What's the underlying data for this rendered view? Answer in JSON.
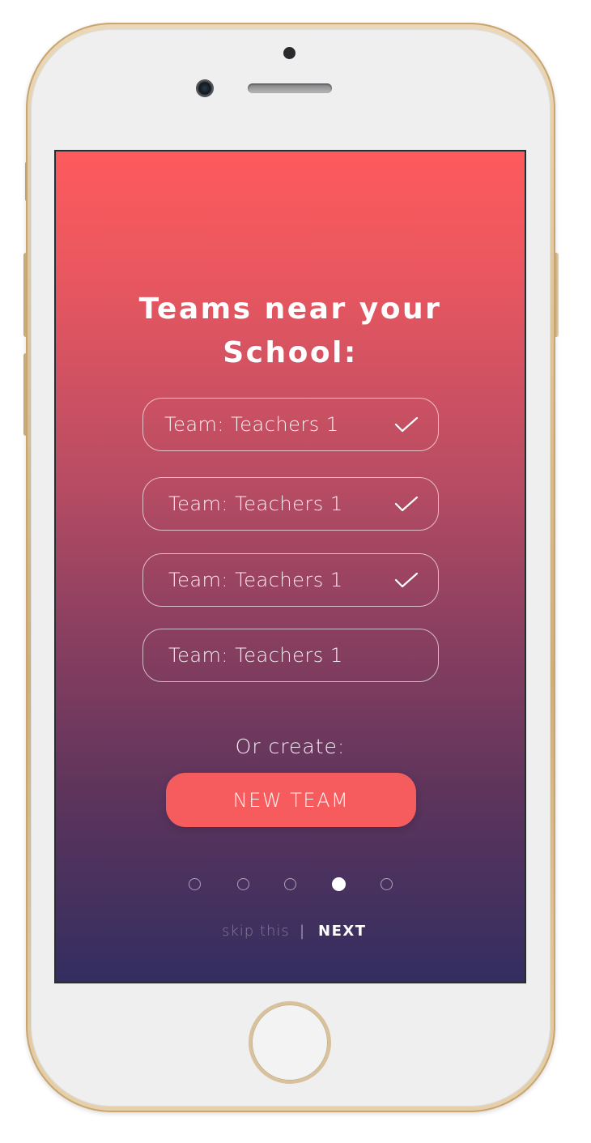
{
  "screen": {
    "title_line1": "Teams near your",
    "title_line2": "School:",
    "teams": [
      {
        "label": "Team: Teachers 1",
        "selected": true
      },
      {
        "label": "Team: Teachers 1",
        "selected": true
      },
      {
        "label": "Team: Teachers 1",
        "selected": true
      },
      {
        "label": "Team: Teachers 1",
        "selected": false
      }
    ],
    "or_create_label": "Or create:",
    "new_team_label": "NEW TEAM",
    "pager": {
      "total": 5,
      "active": 4
    },
    "skip_label": "skip this",
    "divider": "|",
    "next_label": "NEXT"
  },
  "colors": {
    "gradient_top": "#fd5a5c",
    "gradient_bottom": "#332e60",
    "button": "#f65b5d"
  },
  "icons": {
    "selected_indicator": "check-icon"
  }
}
